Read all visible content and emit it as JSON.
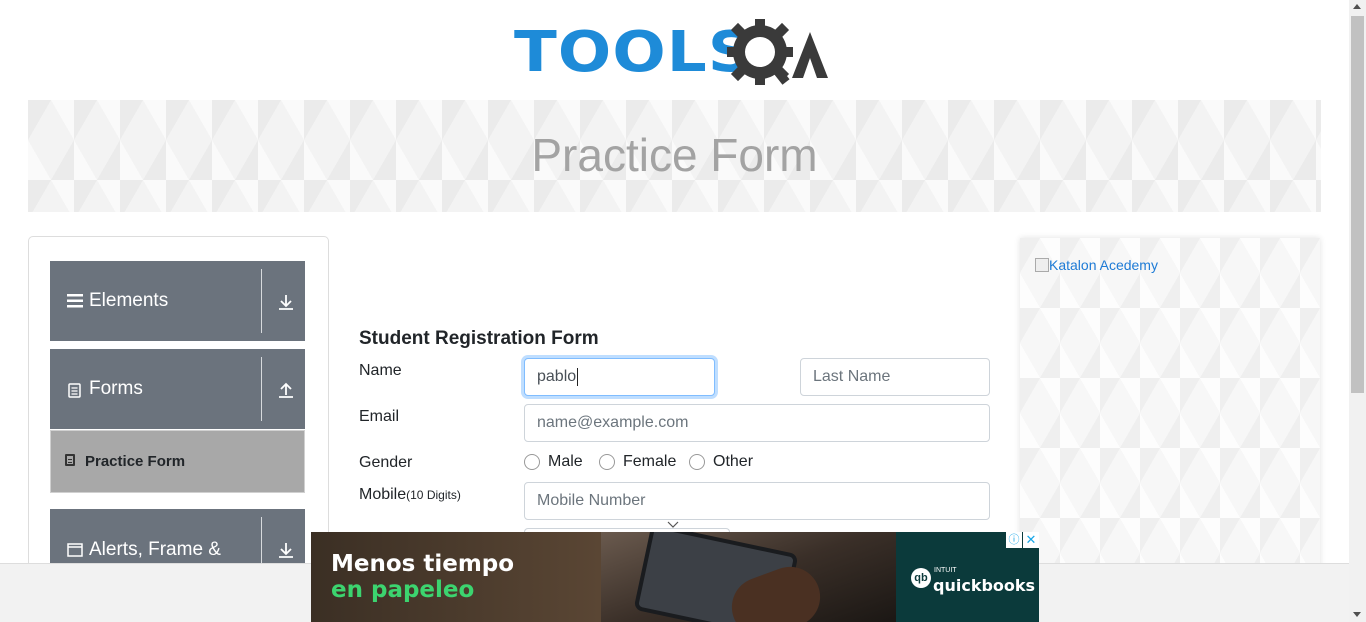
{
  "header": {
    "logo_text": "TOOLS",
    "logo_suffix": "QA"
  },
  "banner": {
    "title": "Practice Form"
  },
  "sidebar": {
    "groups": [
      {
        "label": "Elements",
        "icon": "menu-icon",
        "arrow": "download-arrow-icon"
      },
      {
        "label": "Forms",
        "icon": "document-icon",
        "arrow": "upload-arrow-icon"
      },
      {
        "label": "Alerts, Frame &",
        "icon": "window-icon",
        "arrow": "download-arrow-icon"
      }
    ],
    "active_item": {
      "label": "Practice Form",
      "icon": "html5-icon"
    }
  },
  "form": {
    "title": "Student Registration Form",
    "name_label": "Name",
    "first_name_value": "pablo",
    "last_name_placeholder": "Last Name",
    "email_label": "Email",
    "email_placeholder": "name@example.com",
    "gender_label": "Gender",
    "gender_options": [
      "Male",
      "Female",
      "Other"
    ],
    "mobile_label": "Mobile",
    "mobile_hint": "(10 Digits)",
    "mobile_placeholder": "Mobile Number"
  },
  "sidead": {
    "image_alt": "Katalon Acedemy"
  },
  "ad": {
    "line1": "Menos tiempo",
    "line2": "en papeleo",
    "brand_top": "INTUIT",
    "brand": "quickbooks",
    "brand_color": "#0b3a3b",
    "accent_color": "#3cd46f"
  },
  "colors": {
    "logo_blue": "#1e8bd8",
    "sidebar_group": "#6b737d",
    "sidebar_active": "#a8a8a8"
  }
}
